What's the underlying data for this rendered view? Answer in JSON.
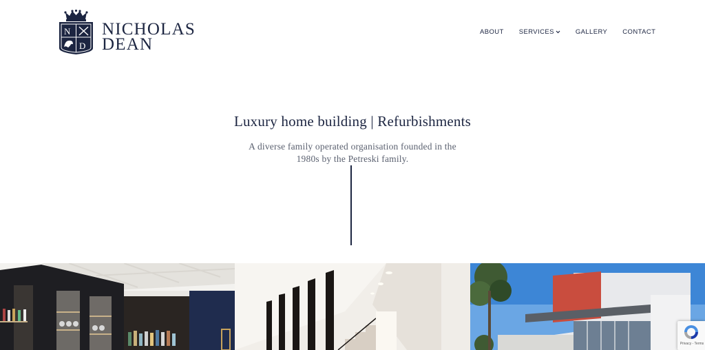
{
  "brand": {
    "crest_letters": [
      "N",
      "D"
    ],
    "name_line1": "NICHOLAS",
    "name_line2": "DEAN"
  },
  "nav": {
    "about": "ABOUT",
    "services": "SERVICES",
    "gallery": "GALLERY",
    "contact": "CONTACT"
  },
  "hero": {
    "title": "Luxury home building | Refurbishments",
    "subtitle": "A diverse family operated organisation founded in the 1980s by the Petreski family."
  },
  "gallery": [
    {
      "subject": "bar cabinet interior"
    },
    {
      "subject": "staircase interior"
    },
    {
      "subject": "modern house exterior"
    }
  ],
  "recaptcha": {
    "footer": "Privacy - Terms"
  },
  "colors": {
    "navy": "#1c2541",
    "text_muted": "#5b6170",
    "background": "#ffffff"
  }
}
